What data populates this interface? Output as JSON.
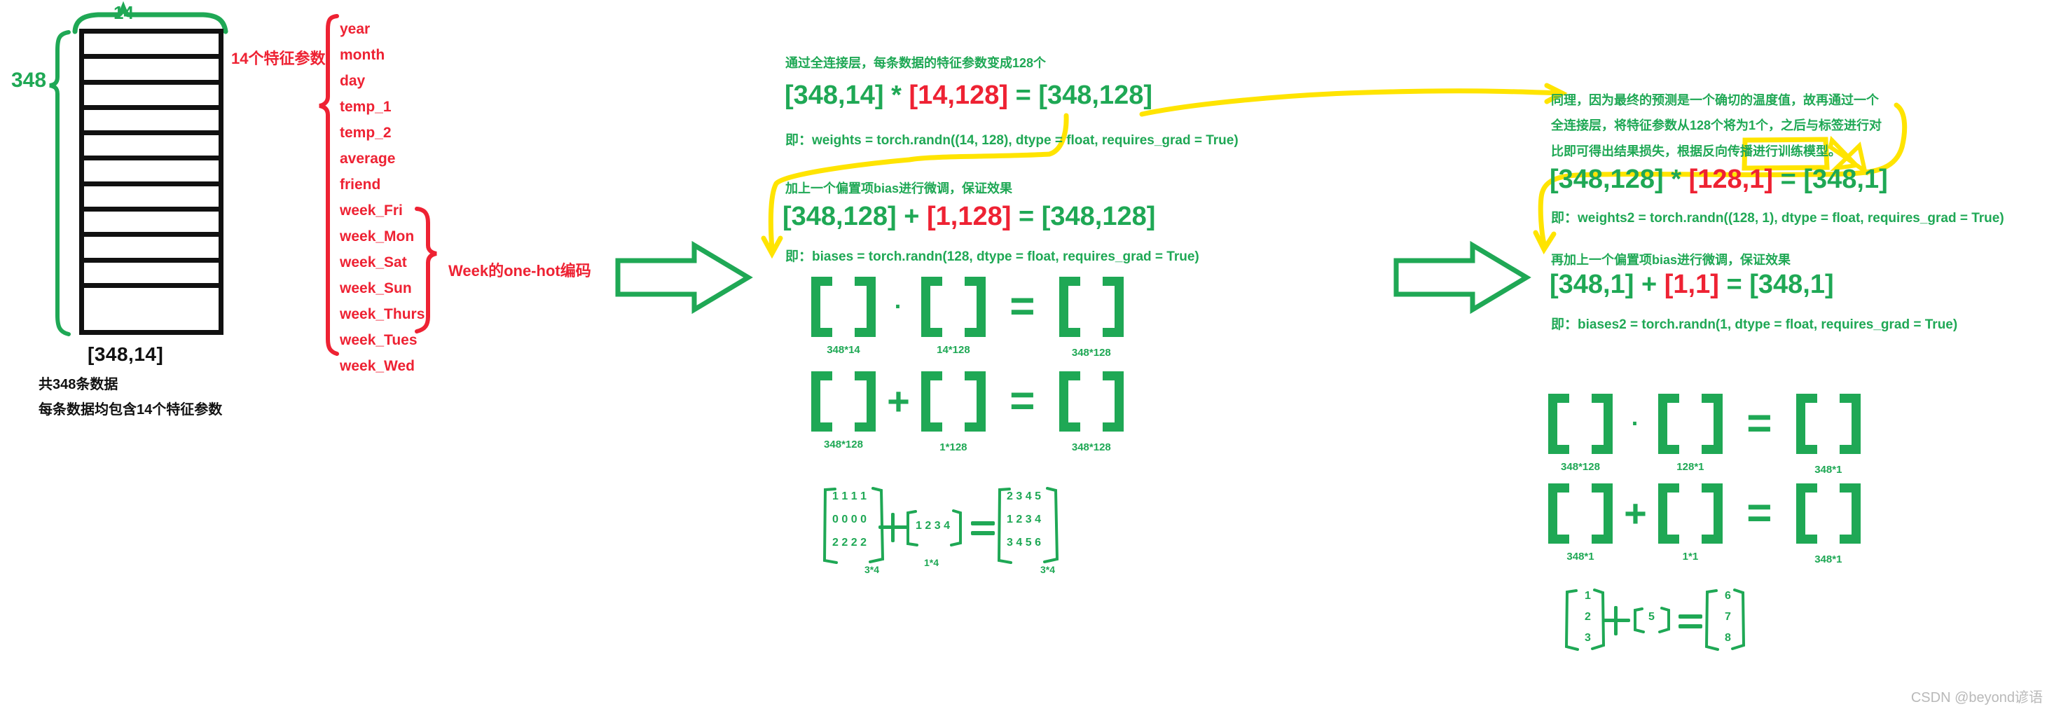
{
  "left_panel": {
    "brace_top_label": "14",
    "brace_left_label": "348",
    "shape_label": "[348,14]",
    "note_line1": "共348条数据",
    "note_line2": "每条数据均包含14个特征参数",
    "feature_count_label": "14个特征参数",
    "onehot_label": "Week的one-hot编码",
    "features": [
      "year",
      "month",
      "day",
      "temp_1",
      "temp_2",
      "average",
      "friend",
      "week_Fri",
      "week_Mon",
      "week_Sat",
      "week_Sun",
      "week_Thurs",
      "week_Tues",
      "week_Wed"
    ]
  },
  "layer1": {
    "note_1": "通过全连接层，每条数据的特征参数变成128个",
    "eq_1": {
      "a": "[348,14]",
      "op": "*",
      "b": "[14,128]",
      "eqsign": "=",
      "c": "[348,128]"
    },
    "code_1": "即：weights = torch.randn((14, 128), dtype = float, requires_grad = True)",
    "note_2": "加上一个偏置项bias进行微调，保证效果",
    "eq_2": {
      "a": "[348,128]",
      "op": "+",
      "b": "[1,128]",
      "eqsign": "=",
      "c": "[348,128]"
    },
    "code_2": "即：biases = torch.randn(128, dtype = float, requires_grad = True)",
    "matmul_row": {
      "op": "·",
      "eqsign": "=",
      "a_caption": "348*14",
      "b_caption": "14*128",
      "c_caption": "348*128"
    },
    "add_row": {
      "op": "+",
      "eqsign": "=",
      "a_caption": "348*128",
      "b_caption": "1*128",
      "c_caption": "348*128"
    },
    "example": {
      "a_rows": [
        [
          "1",
          "1",
          "1",
          "1"
        ],
        [
          "0",
          "0",
          "0",
          "0"
        ],
        [
          "2",
          "2",
          "2",
          "2"
        ]
      ],
      "a_caption": "3*4",
      "op": "+",
      "b_rows": [
        [
          "1",
          "2",
          "3",
          "4"
        ]
      ],
      "b_caption": "1*4",
      "eqsign": "=",
      "c_rows": [
        [
          "2",
          "3",
          "4",
          "5"
        ],
        [
          "1",
          "2",
          "3",
          "4"
        ],
        [
          "3",
          "4",
          "5",
          "6"
        ]
      ],
      "c_caption": "3*4"
    }
  },
  "layer2": {
    "note_line1": "同理，因为最终的预测是一个确切的温度值，故再通过一个",
    "note_line2": "全连接层，将特征参数从128个将为1个，之后与标签进行对",
    "note_line3": "比即可得出结果损失，根据反向传播进行训练模型。",
    "eq_1": {
      "a": "[348,128]",
      "op": "*",
      "b": "[128,1]",
      "eqsign": "=",
      "c": "[348,1]"
    },
    "code_1": "即：weights2 = torch.randn((128, 1), dtype = float, requires_grad = True)",
    "note_2": "再加上一个偏置项bias进行微调，保证效果",
    "eq_2": {
      "a": "[348,1]",
      "op": "+",
      "b": "[1,1]",
      "eqsign": "=",
      "c": "[348,1]"
    },
    "code_2": "即：biases2 = torch.randn(1, dtype = float, requires_grad = True)",
    "matmul_row": {
      "op": "·",
      "eqsign": "=",
      "a_caption": "348*128",
      "b_caption": "128*1",
      "c_caption": "348*1"
    },
    "add_row": {
      "op": "+",
      "eqsign": "=",
      "a_caption": "348*1",
      "b_caption": "1*1",
      "c_caption": "348*1"
    },
    "example": {
      "a_rows": [
        [
          "1"
        ],
        [
          "2"
        ],
        [
          "3"
        ]
      ],
      "op": "+",
      "b_rows": [
        [
          "5"
        ]
      ],
      "eqsign": "=",
      "c_rows": [
        [
          "6"
        ],
        [
          "7"
        ],
        [
          "8"
        ]
      ]
    }
  },
  "icons": {
    "arrow_1": "right-arrow-icon",
    "arrow_2": "right-arrow-icon"
  },
  "colors": {
    "green": "#1fa855",
    "red": "#ee2233",
    "yellow": "#ffe400",
    "black": "#111111",
    "watermark": "#b9b9b9"
  },
  "watermark": "CSDN @beyond谚语"
}
